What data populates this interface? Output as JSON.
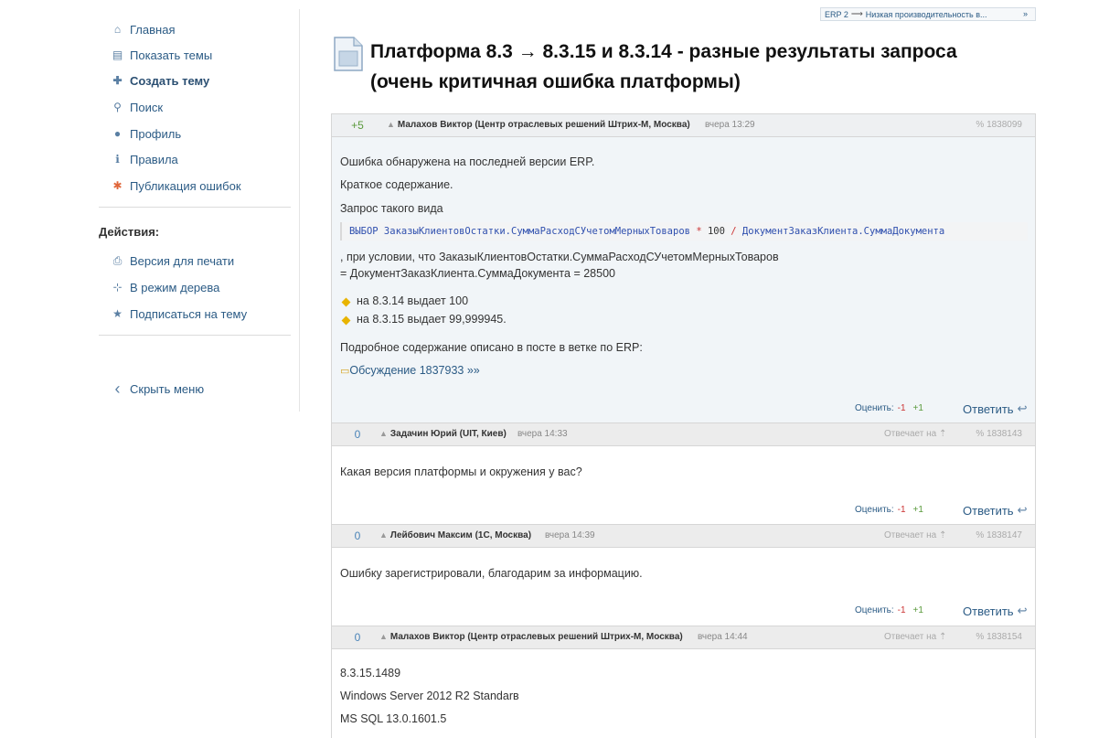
{
  "sidebar": {
    "items": [
      {
        "label": "Главная",
        "icon": "home-icon",
        "glyph": "⌂"
      },
      {
        "label": "Показать темы",
        "icon": "book-icon",
        "glyph": "▤"
      },
      {
        "label": "Создать тему",
        "icon": "plus-icon",
        "glyph": "✚"
      },
      {
        "label": "Поиск",
        "icon": "search-icon",
        "glyph": "⚲"
      },
      {
        "label": "Профиль",
        "icon": "user-icon",
        "glyph": "●"
      },
      {
        "label": "Правила",
        "icon": "info-icon",
        "glyph": "ℹ"
      },
      {
        "label": "Публикация ошибок",
        "icon": "bug-icon",
        "glyph": "✱"
      }
    ],
    "actions_title": "Действия:",
    "actions": [
      {
        "label": "Версия для печати",
        "icon": "print-icon",
        "glyph": "⎙"
      },
      {
        "label": "В режим дерева",
        "icon": "tree-icon",
        "glyph": "⊹"
      },
      {
        "label": "Подписаться на тему",
        "icon": "star-icon",
        "glyph": "★"
      }
    ],
    "hide_menu": {
      "label": "Скрыть меню",
      "icon": "chevron-left-icon",
      "glyph": "‹"
    }
  },
  "breadcrumb": {
    "section": "ERP 2",
    "arrow": "⟶",
    "topic": "Низкая производительность в...",
    "more": "»"
  },
  "title": {
    "line1": "Платформа 8.3 →   8.3.15 и 8.3.14 - разные результаты запроса",
    "line2": "(очень критичная ошибка платформы)"
  },
  "labels": {
    "rate": "Оценить:",
    "minus": "-1",
    "plus": "+1",
    "reply": "Ответить",
    "reply_glyph": "↩",
    "replying_to": "Отвечает на",
    "user_glyph": "▲",
    "link_glyph": "%"
  },
  "posts": [
    {
      "score": "+5",
      "author": "Малахов Виктор (Центр отраслевых решений Штрих-М, Москва)",
      "time": "вчера 13:29",
      "id": "1838099",
      "lines": {
        "l1": "Ошибка обнаружена на последней версии ERP.",
        "l2": "Краткое содержание.",
        "l3": "Запрос такого вида",
        "code_a": "ВЫБОР ЗаказыКлиентовОстатки.СуммаРасходСУчетомМерныхТоваров",
        "code_op1": "*",
        "code_num": "100",
        "code_op2": "/",
        "code_b": "ДокументЗаказКлиента.СуммаДокумента",
        "l4": ",  при условии, что ЗаказыКлиентовОстатки.СуммаРасходСУчетомМерныхТоваров",
        "l5": "= ДокументЗаказКлиента.СуммаДокумента = 28500",
        "b1": "на 8.3.14 выдает 100",
        "b2": "на 8.3.15 выдает 99,999945.",
        "l6": "Подробное содержание описано в посте в ветке по ERP:",
        "link": "Обсуждение 1837933 »»"
      }
    },
    {
      "score": "0",
      "author": "Задачин Юрий (UIT, Киев)",
      "time": "вчера 14:33",
      "id": "1838143",
      "text": "Какая версия платформы и окружения у вас?"
    },
    {
      "score": "0",
      "author": "Лейбович Максим (1С, Москва)",
      "time": "вчера 14:39",
      "id": "1838147",
      "text": "Ошибку зарегистрировали, благодарим за информацию."
    },
    {
      "score": "0",
      "author": "Малахов Виктор (Центр отраслевых решений Штрих-М, Москва)",
      "time": "вчера 14:44",
      "id": "1838154",
      "l1": "8.3.15.1489",
      "l2": "Windows Server 2012 R2 Standarв",
      "l3": "MS SQL 13.0.1601.5"
    }
  ]
}
